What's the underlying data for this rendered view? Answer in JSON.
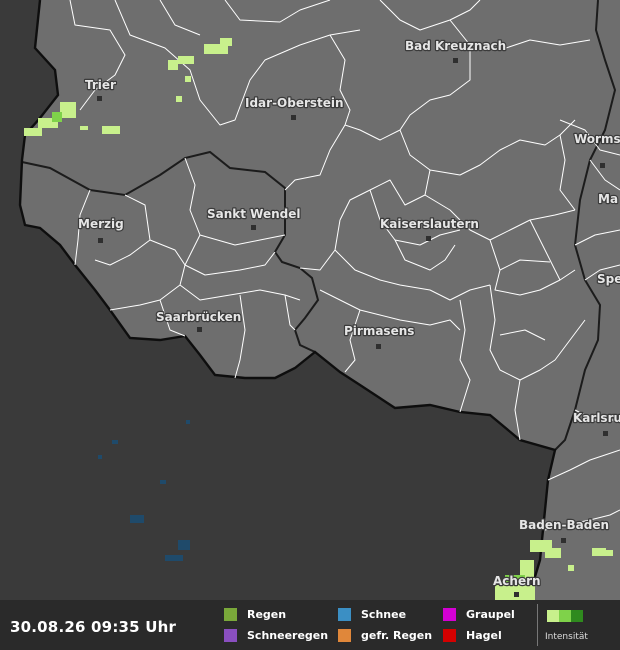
{
  "map": {
    "cities": [
      {
        "id": "trier",
        "name": "Trier"
      },
      {
        "id": "bad-kreuznach",
        "name": "Bad Kreuznach"
      },
      {
        "id": "idar-oberstein",
        "name": "Idar-Oberstein"
      },
      {
        "id": "worms",
        "name": "Worms"
      },
      {
        "id": "merzig",
        "name": "Merzig"
      },
      {
        "id": "sankt-wendel",
        "name": "Sankt Wendel"
      },
      {
        "id": "kaiserslautern",
        "name": "Kaiserslautern"
      },
      {
        "id": "saarbruecken",
        "name": "Saarbrücken"
      },
      {
        "id": "pirmasens",
        "name": "Pirmasens"
      },
      {
        "id": "karlsruhe",
        "name": "Karlsru"
      },
      {
        "id": "baden-baden",
        "name": "Baden-Baden"
      },
      {
        "id": "achern",
        "name": "Achern"
      },
      {
        "id": "mannheim-partial",
        "name": "Ma"
      },
      {
        "id": "speyer-partial",
        "name": "Spe"
      }
    ],
    "colors": {
      "germany_land": "#6e6e6e",
      "foreign_land": "#3a3a3a",
      "borders": "#ffffff",
      "country_border": "#111111",
      "precip_light": "#c8f08c",
      "precip_medium": "#7fd24a"
    }
  },
  "legend": {
    "timestamp": "30.08.26 09:35 Uhr",
    "items": [
      {
        "label": "Regen",
        "color": "#7aa83a"
      },
      {
        "label": "Schnee",
        "color": "#3b8fc4"
      },
      {
        "label": "Graupel",
        "color": "#d400d4"
      },
      {
        "label": "Schneeregen",
        "color": "#8a4fc0"
      },
      {
        "label": "gefr. Regen",
        "color": "#e0873a"
      },
      {
        "label": "Hagel",
        "color": "#d40000"
      }
    ],
    "intensity_label": "Intensität",
    "intensity_colors": [
      "#c8f08c",
      "#7fd24a",
      "#2f8a1e"
    ]
  }
}
